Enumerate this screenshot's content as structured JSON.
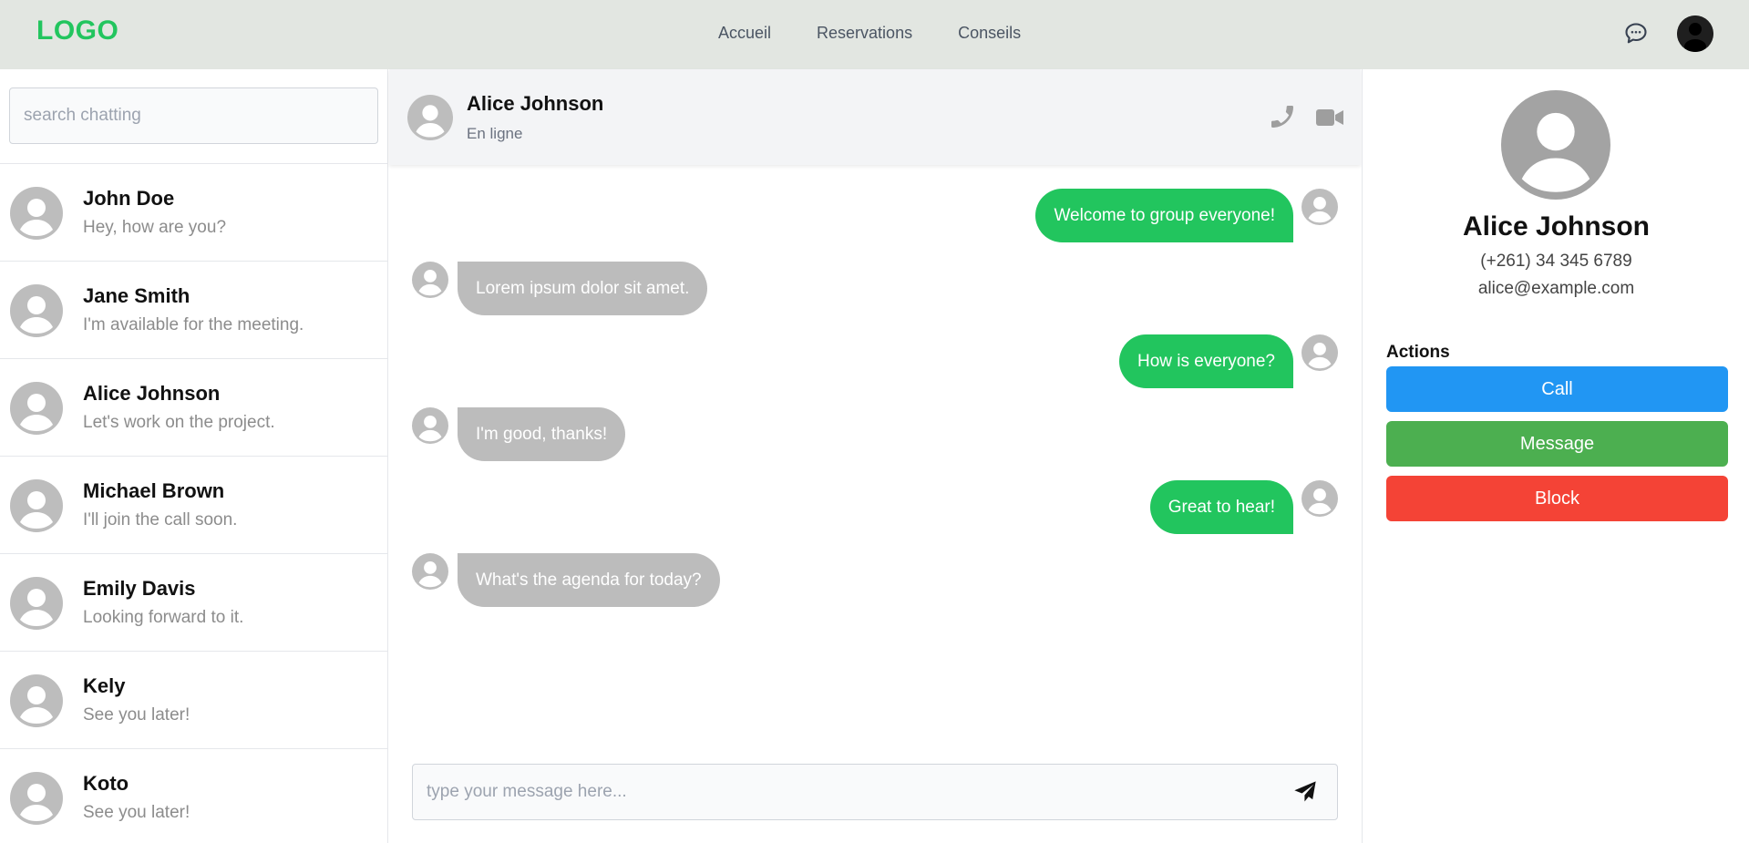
{
  "navbar": {
    "logo": "LOGO",
    "links": [
      "Accueil",
      "Reservations",
      "Conseils"
    ],
    "chat_icon": "chat-bubble-icon",
    "avatar_icon": "user-avatar-icon"
  },
  "sidebar": {
    "search_placeholder": "search chatting",
    "contacts": [
      {
        "name": "John Doe",
        "preview": "Hey, how are you?"
      },
      {
        "name": "Jane Smith",
        "preview": "I'm available for the meeting."
      },
      {
        "name": "Alice Johnson",
        "preview": "Let's work on the project."
      },
      {
        "name": "Michael Brown",
        "preview": "I'll join the call soon."
      },
      {
        "name": "Emily Davis",
        "preview": "Looking forward to it."
      },
      {
        "name": "Kely",
        "preview": "See you later!"
      },
      {
        "name": "Koto",
        "preview": "See you later!"
      }
    ]
  },
  "chat": {
    "title": "Alice Johnson",
    "status": "En ligne",
    "messages": [
      {
        "direction": "out",
        "text": "Welcome to group everyone!"
      },
      {
        "direction": "in",
        "text": "Lorem ipsum dolor sit amet."
      },
      {
        "direction": "out",
        "text": "How is everyone?"
      },
      {
        "direction": "in",
        "text": "I'm good, thanks!"
      },
      {
        "direction": "out",
        "text": "Great to hear!"
      },
      {
        "direction": "in",
        "text": "What's the agenda for today?"
      }
    ],
    "composer_placeholder": "type your message here..."
  },
  "profile": {
    "name": "Alice Johnson",
    "phone": "(+261) 34 345 6789",
    "email": "alice@example.com",
    "actions_title": "Actions",
    "call_label": "Call",
    "message_label": "Message",
    "block_label": "Block"
  },
  "colors": {
    "brand": "#22c55e",
    "navbar_bg": "#e2e6e1",
    "incoming_bubble": "#bcbcbc",
    "call": "#2196f3",
    "message": "#4caf50",
    "block": "#f44336"
  }
}
